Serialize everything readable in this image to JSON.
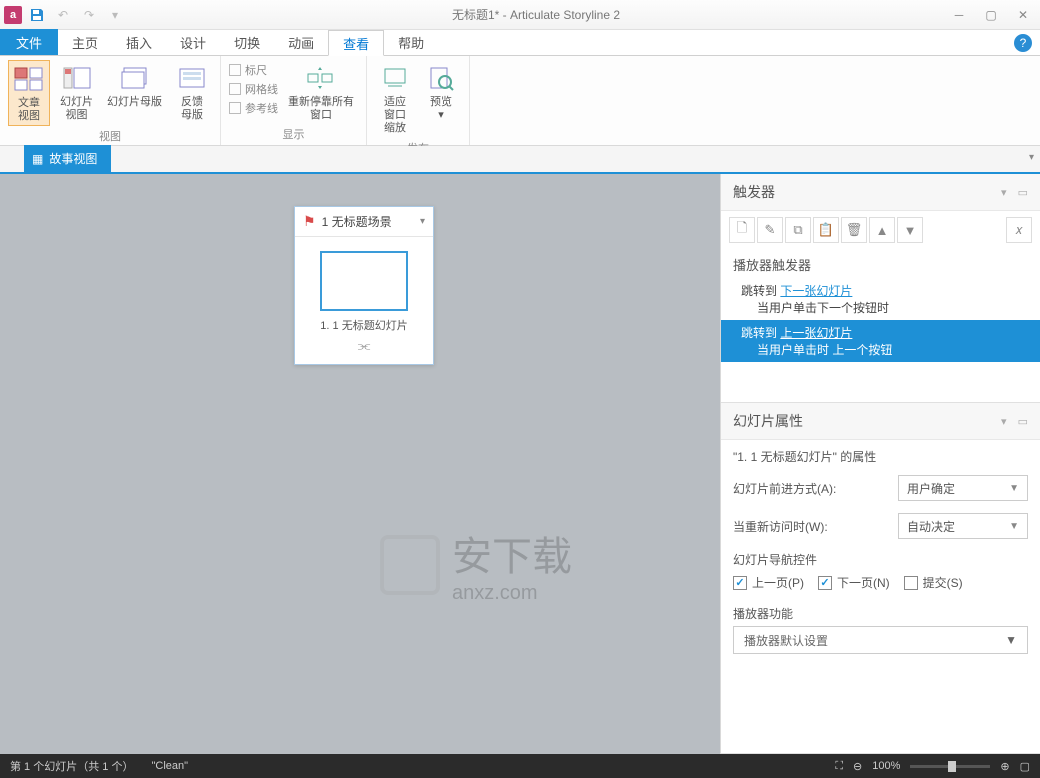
{
  "titlebar": {
    "title": "无标题1* - Articulate Storyline 2"
  },
  "tabs": {
    "file": "文件",
    "items": [
      "主页",
      "插入",
      "设计",
      "切换",
      "动画",
      "查看",
      "帮助"
    ],
    "active": "查看"
  },
  "ribbon": {
    "group_view": {
      "label": "视图",
      "btn_story": "文章\n视图",
      "btn_slide": "幻灯片\n视图",
      "btn_master": "幻灯片母版",
      "btn_feedback": "反馈\n母版"
    },
    "group_show": {
      "label": "显示",
      "chk_ruler": "标尺",
      "chk_grid": "网格线",
      "chk_guide": "参考线",
      "btn_redock": "重新停靠所有\n窗口"
    },
    "group_publish": {
      "label": "发布",
      "btn_fit": "适应\n窗口\n缩放",
      "btn_preview": "预览\n▾"
    }
  },
  "subtab": {
    "label": "故事视图"
  },
  "scene": {
    "title": "1 无标题场景",
    "slide": "1. 1 无标题幻灯片"
  },
  "triggers": {
    "title": "触发器",
    "section": "播放器触发器",
    "items": [
      {
        "act": "跳转到",
        "target": "下一张幻灯片",
        "sub": "当用户单击下一个按钮时",
        "sel": false
      },
      {
        "act": "跳转到",
        "target": "上一张幻灯片",
        "sub": "当用户单击时 上一个按钮",
        "sel": true
      }
    ]
  },
  "props": {
    "title": "幻灯片属性",
    "subtitle": "\"1. 1 无标题幻灯片\" 的属性",
    "advance_label": "幻灯片前进方式(A):",
    "advance_value": "用户确定",
    "revisit_label": "当重新访问时(W):",
    "revisit_value": "自动决定",
    "nav_title": "幻灯片导航控件",
    "nav_prev": "上一页(P)",
    "nav_next": "下一页(N)",
    "nav_submit": "提交(S)",
    "func_title": "播放器功能",
    "func_value": "播放器默认设置"
  },
  "status": {
    "slide": "第 1 个幻灯片（共 1 个）",
    "theme": "\"Clean\"",
    "zoom": "100%"
  },
  "watermark": {
    "text": "安下载",
    "url": "anxz.com"
  }
}
